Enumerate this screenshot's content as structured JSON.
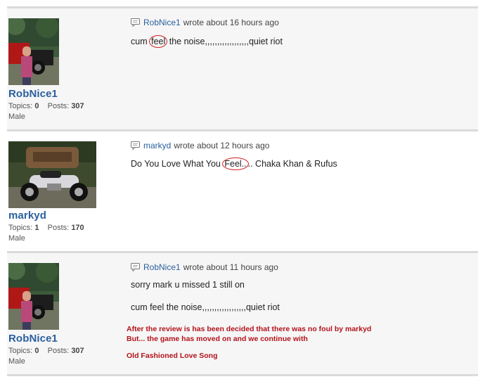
{
  "posts": [
    {
      "author": "RobNice1",
      "wrote": "wrote about 16 hours ago",
      "topics_label": "Topics:",
      "topics": "0",
      "posts_label": "Posts:",
      "posts": "307",
      "gender": "Male",
      "msg_before": "cum ",
      "msg_circled": "feel",
      "msg_after": " the noise,,,,,,,,,,,,,,,,,,quiet riot"
    },
    {
      "author": "markyd",
      "wrote": "wrote about 12 hours ago",
      "topics_label": "Topics:",
      "topics": "1",
      "posts_label": "Posts:",
      "posts": "170",
      "gender": "Male",
      "msg_before": "Do You Love What You ",
      "msg_circled": "Feel..",
      "msg_after": ".. Chaka Khan & Rufus"
    },
    {
      "author": "RobNice1",
      "wrote": "wrote about 11 hours ago",
      "topics_label": "Topics:",
      "topics": "0",
      "posts_label": "Posts:",
      "posts": "307",
      "gender": "Male",
      "msg_line1": "sorry mark u missed 1 still on",
      "msg_line2": "cum feel the noise,,,,,,,,,,,,,,,,,,quiet riot",
      "note_line1": "After the review is has been decided that there was no foul by markyd",
      "note_line2": "But... the game has moved on and we continue with",
      "note_line3": "Old Fashioned Love Song"
    }
  ],
  "icons": {
    "comment": "comment-bubble-icon"
  },
  "colors": {
    "username": "#2a5f9e",
    "annotation": "#b3121b",
    "circle": "#d42020"
  }
}
